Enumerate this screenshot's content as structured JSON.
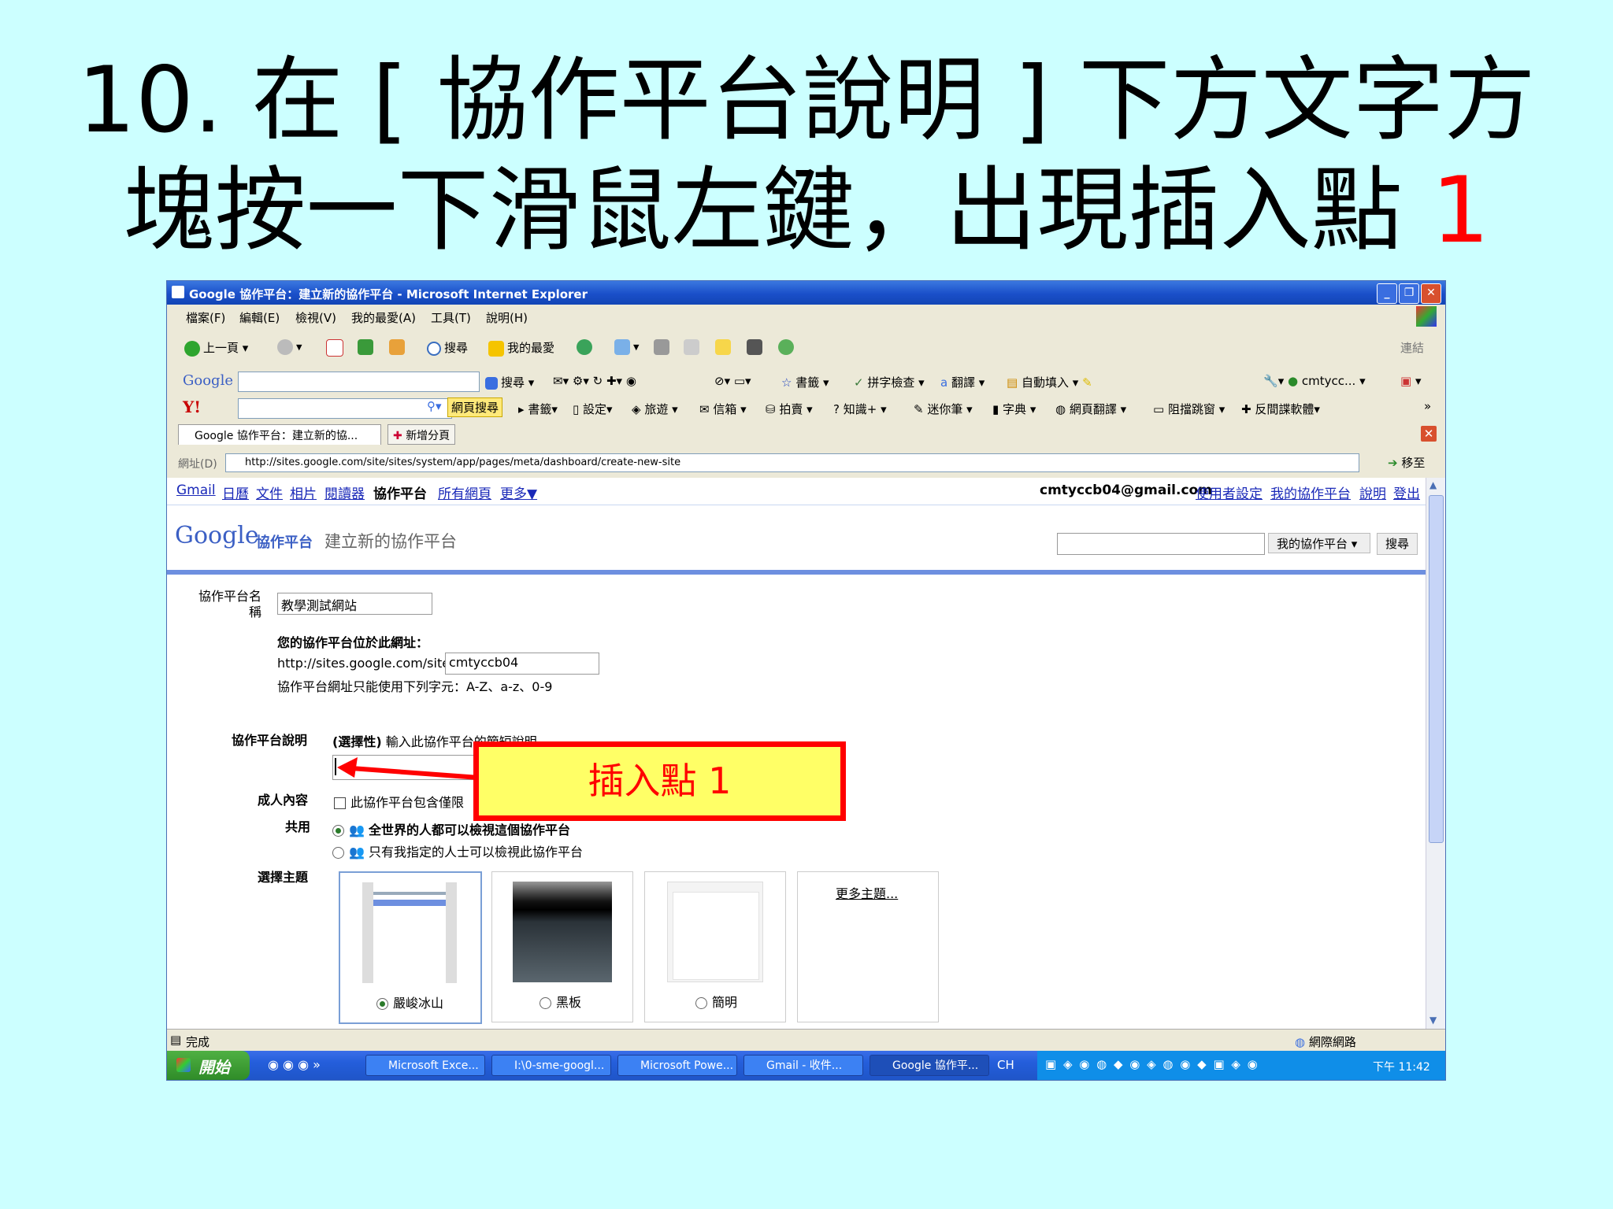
{
  "slide": {
    "title_line1": "10. 在 [ 協作平台說明 ] 下方文字方",
    "title_line2": "塊按一下滑鼠左鍵，出現插入點",
    "title_number": "1"
  },
  "window": {
    "title": "Google 協作平台：建立新的協作平台 - Microsoft Internet Explorer",
    "buttons": [
      "_",
      "❐",
      "✕"
    ]
  },
  "menu": [
    "檔案(F)",
    "編輯(E)",
    "檢視(V)",
    "我的最愛(A)",
    "工具(T)",
    "說明(H)"
  ],
  "toolbar": {
    "back": "上一頁",
    "search": "搜尋",
    "favorites": "我的最愛",
    "links": "連結"
  },
  "google_toolbar": {
    "logo": "Google",
    "items": [
      "搜尋",
      "書籤",
      "拼字檢查",
      "翻譯",
      "自動填入",
      "cmtycc..."
    ]
  },
  "yahoo_toolbar": {
    "logo": "Y!",
    "items": [
      "網頁搜尋",
      "書籤",
      "設定",
      "旅遊",
      "信箱",
      "拍賣",
      "知識+",
      "迷你筆",
      "字典",
      "網頁翻譯",
      "阻擋跳窗",
      "反間諜軟體"
    ]
  },
  "tabs": {
    "active": "Google 協作平台：建立新的協...",
    "new": "新增分頁"
  },
  "address": {
    "label": "網址(D)",
    "url": "http://sites.google.com/site/sites/system/app/pages/meta/dashboard/create-new-site",
    "go": "移至"
  },
  "gnav": {
    "links": [
      "Gmail",
      "日曆",
      "文件",
      "相片",
      "閱讀器"
    ],
    "current": "協作平台",
    "more_links": [
      "所有網頁",
      "更多▼"
    ],
    "email": "cmtyccb04@gmail.com",
    "right_links": [
      "使用者設定",
      "我的協作平台",
      "說明",
      "登出"
    ]
  },
  "header": {
    "logo": "Google",
    "product": "協作平台",
    "page": "建立新的協作平台",
    "dropdown": "我的協作平台",
    "search_button": "搜尋"
  },
  "form": {
    "name_label": "協作平台名稱",
    "name_value": "教學測試網站",
    "url_heading": "您的協作平台位於此網址：",
    "url_prefix": "http://sites.google.com/site/",
    "url_value": "cmtyccb04",
    "url_hint": "協作平台網址只能使用下列字元：A-Z、a-z、0-9",
    "desc_label": "協作平台說明",
    "desc_hint_bold": "(選擇性)",
    "desc_hint": "輸入此協作平台的簡短說明",
    "adult_label": "成人內容",
    "adult_text": "此協作平台包含僅限",
    "share_label": "共用",
    "share_all": "全世界的人都可以檢視這個協作平台",
    "share_only": "只有我指定的人士可以檢視此協作平台",
    "theme_label": "選擇主題",
    "themes": [
      "嚴峻冰山",
      "黑板",
      "簡明"
    ],
    "more_themes": "更多主題..."
  },
  "status": {
    "text": "完成",
    "zone": "網際網路"
  },
  "taskbar": {
    "start": "開始",
    "tasks": [
      "Microsoft Exce...",
      "I:\\0-sme-googl...",
      "Microsoft Powe...",
      "Gmail - 收件...",
      "Google 協作平..."
    ],
    "lang": "CH",
    "clock": "下午 11:42"
  },
  "callout": {
    "text": "插入點 1"
  },
  "colors": {
    "background": "#ccffff",
    "callout_fill": "#ffff66",
    "callout_border": "#ff0000",
    "link": "#1a29b8"
  }
}
